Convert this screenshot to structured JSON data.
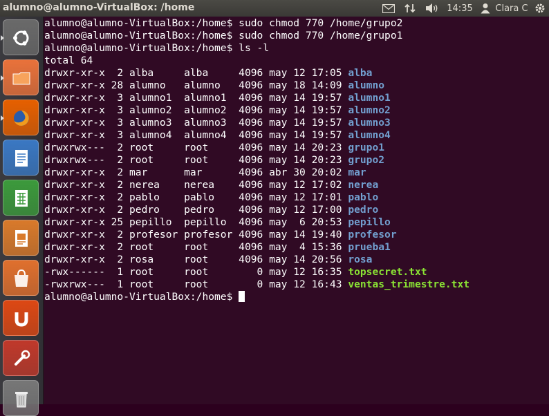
{
  "topbar": {
    "window_title": "alumno@alumno-VirtualBox: /home",
    "mail_icon": "mail-icon",
    "network_icon": "network-icon",
    "volume_icon": "volume-icon",
    "clock": "14:35",
    "user_icon": "user-icon",
    "user_name": "Clara C",
    "settings_icon": "gear-icon"
  },
  "launcher": {
    "items": [
      {
        "name": "ubuntu-dash",
        "icon": "ubuntu-logo-icon",
        "color": "#6a6a6a"
      },
      {
        "name": "files",
        "icon": "folder-icon",
        "color": "#e9723b"
      },
      {
        "name": "firefox",
        "icon": "firefox-icon",
        "color": "#e66000"
      },
      {
        "name": "libreoffice-writer",
        "icon": "writer-icon",
        "color": "#3a78c3"
      },
      {
        "name": "libreoffice-calc",
        "icon": "calc-icon",
        "color": "#3c9a3c"
      },
      {
        "name": "libreoffice-impress",
        "icon": "impress-icon",
        "color": "#d97a2b"
      },
      {
        "name": "software-center",
        "icon": "shopping-bag-icon",
        "color": "#e0702e"
      },
      {
        "name": "ubuntu-one",
        "icon": "ubuntu-one-icon",
        "color": "#dd4814"
      },
      {
        "name": "system-settings",
        "icon": "settings-tools-icon",
        "color": "#c0392b"
      },
      {
        "name": "trash",
        "icon": "trash-icon",
        "color": "#777777"
      }
    ]
  },
  "terminal": {
    "prompt": "alumno@alumno-VirtualBox:/home$",
    "commands": [
      "sudo chmod 770 /home/grupo2",
      "sudo chmod 770 /home/grupo1",
      "ls -l"
    ],
    "total": "total 64",
    "listing": [
      {
        "perm": "drwxr-xr-x",
        "links": "2",
        "owner": "alba",
        "group": "alba",
        "size": "4096",
        "date": "may 12 17:05",
        "name": "alba",
        "kind": "dir"
      },
      {
        "perm": "drwxr-xr-x",
        "links": "28",
        "owner": "alumno",
        "group": "alumno",
        "size": "4096",
        "date": "may 18 14:09",
        "name": "alumno",
        "kind": "dir"
      },
      {
        "perm": "drwxr-xr-x",
        "links": "3",
        "owner": "alumno1",
        "group": "alumno1",
        "size": "4096",
        "date": "may 14 19:57",
        "name": "alumno1",
        "kind": "dir"
      },
      {
        "perm": "drwxr-xr-x",
        "links": "3",
        "owner": "alumno2",
        "group": "alumno2",
        "size": "4096",
        "date": "may 14 19:57",
        "name": "alumno2",
        "kind": "dir"
      },
      {
        "perm": "drwxr-xr-x",
        "links": "3",
        "owner": "alumno3",
        "group": "alumno3",
        "size": "4096",
        "date": "may 14 19:57",
        "name": "alumno3",
        "kind": "dir"
      },
      {
        "perm": "drwxr-xr-x",
        "links": "3",
        "owner": "alumno4",
        "group": "alumno4",
        "size": "4096",
        "date": "may 14 19:57",
        "name": "alumno4",
        "kind": "dir"
      },
      {
        "perm": "drwxrwx---",
        "links": "2",
        "owner": "root",
        "group": "root",
        "size": "4096",
        "date": "may 14 20:23",
        "name": "grupo1",
        "kind": "dir"
      },
      {
        "perm": "drwxrwx---",
        "links": "2",
        "owner": "root",
        "group": "root",
        "size": "4096",
        "date": "may 14 20:23",
        "name": "grupo2",
        "kind": "dir"
      },
      {
        "perm": "drwxr-xr-x",
        "links": "2",
        "owner": "mar",
        "group": "mar",
        "size": "4096",
        "date": "abr 30 20:02",
        "name": "mar",
        "kind": "dir"
      },
      {
        "perm": "drwxr-xr-x",
        "links": "2",
        "owner": "nerea",
        "group": "nerea",
        "size": "4096",
        "date": "may 12 17:02",
        "name": "nerea",
        "kind": "dir"
      },
      {
        "perm": "drwxr-xr-x",
        "links": "2",
        "owner": "pablo",
        "group": "pablo",
        "size": "4096",
        "date": "may 12 17:01",
        "name": "pablo",
        "kind": "dir"
      },
      {
        "perm": "drwxr-xr-x",
        "links": "2",
        "owner": "pedro",
        "group": "pedro",
        "size": "4096",
        "date": "may 12 17:00",
        "name": "pedro",
        "kind": "dir"
      },
      {
        "perm": "drwxr-xr-x",
        "links": "25",
        "owner": "pepillo",
        "group": "pepillo",
        "size": "4096",
        "date": "may  6 20:53",
        "name": "pepillo",
        "kind": "dir"
      },
      {
        "perm": "drwxr-xr-x",
        "links": "2",
        "owner": "profesor",
        "group": "profesor",
        "size": "4096",
        "date": "may 14 19:40",
        "name": "profesor",
        "kind": "dir"
      },
      {
        "perm": "drwxr-xr-x",
        "links": "2",
        "owner": "root",
        "group": "root",
        "size": "4096",
        "date": "may  4 15:36",
        "name": "prueba1",
        "kind": "dir"
      },
      {
        "perm": "drwxr-xr-x",
        "links": "2",
        "owner": "rosa",
        "group": "root",
        "size": "4096",
        "date": "may 14 20:56",
        "name": "rosa",
        "kind": "dir"
      },
      {
        "perm": "-rwx------",
        "links": "1",
        "owner": "root",
        "group": "root",
        "size": "0",
        "date": "may 12 16:35",
        "name": "topsecret.txt",
        "kind": "exe"
      },
      {
        "perm": "-rwxrwx---",
        "links": "1",
        "owner": "root",
        "group": "root",
        "size": "0",
        "date": "may 12 16:43",
        "name": "ventas_trimestre.txt",
        "kind": "exe"
      }
    ],
    "colors": {
      "background": "#300a24",
      "text": "#ffffff",
      "directory": "#729fcf",
      "executable": "#8ae234"
    }
  }
}
